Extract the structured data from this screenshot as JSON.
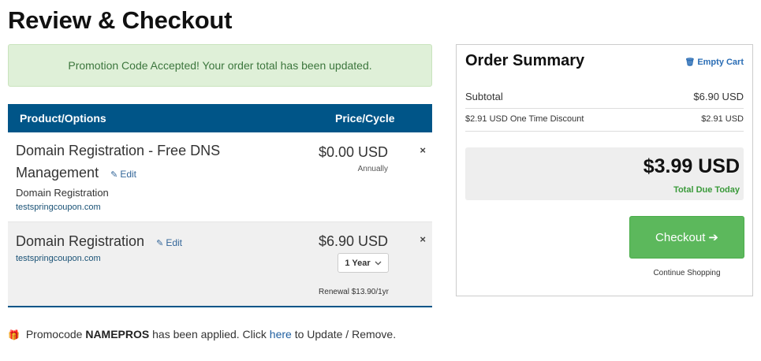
{
  "page": {
    "title": "Review & Checkout"
  },
  "alert": {
    "text": "Promotion Code Accepted! Your order total has been updated."
  },
  "cart": {
    "headers": {
      "product": "Product/Options",
      "price": "Price/Cycle"
    },
    "items": [
      {
        "name_line1": "Domain Registration - Free DNS",
        "name_line2": "Management",
        "edit_label": "Edit",
        "type": "Domain Registration",
        "domain": "testspringcoupon.com",
        "price": "$0.00 USD",
        "cycle": "Annually",
        "remove": "×"
      },
      {
        "name": "Domain Registration",
        "edit_label": "Edit",
        "domain": "testspringcoupon.com",
        "price": "$6.90 USD",
        "term_selected": "1 Year",
        "renewal": "Renewal $13.90/1yr",
        "remove": "×"
      }
    ]
  },
  "promo": {
    "prefix": "Promocode",
    "code": "NAMEPROS",
    "middle": "has been applied. Click",
    "link": "here",
    "suffix": "to Update / Remove."
  },
  "summary": {
    "title": "Order Summary",
    "empty_cart": "Empty Cart",
    "subtotal_label": "Subtotal",
    "subtotal_value": "$6.90 USD",
    "discount_label": "$2.91 USD One Time Discount",
    "discount_value": "$2.91 USD",
    "total": "$3.99 USD",
    "total_due_label": "Total Due Today",
    "checkout_label": "Checkout",
    "continue_label": "Continue Shopping"
  },
  "icons": {
    "edit": "pencil-icon",
    "remove": "close-icon",
    "dropdown": "chevron-down-icon",
    "empty_cart": "trash-icon",
    "checkout": "arrow-right-icon",
    "promo": "gift-icon"
  },
  "colors": {
    "header_bg": "#005588",
    "alert_bg": "#dff0d8",
    "alert_text": "#3c763d",
    "checkout_bg": "#5cb85c",
    "link": "#336699",
    "total_due": "#3a9a3a"
  }
}
